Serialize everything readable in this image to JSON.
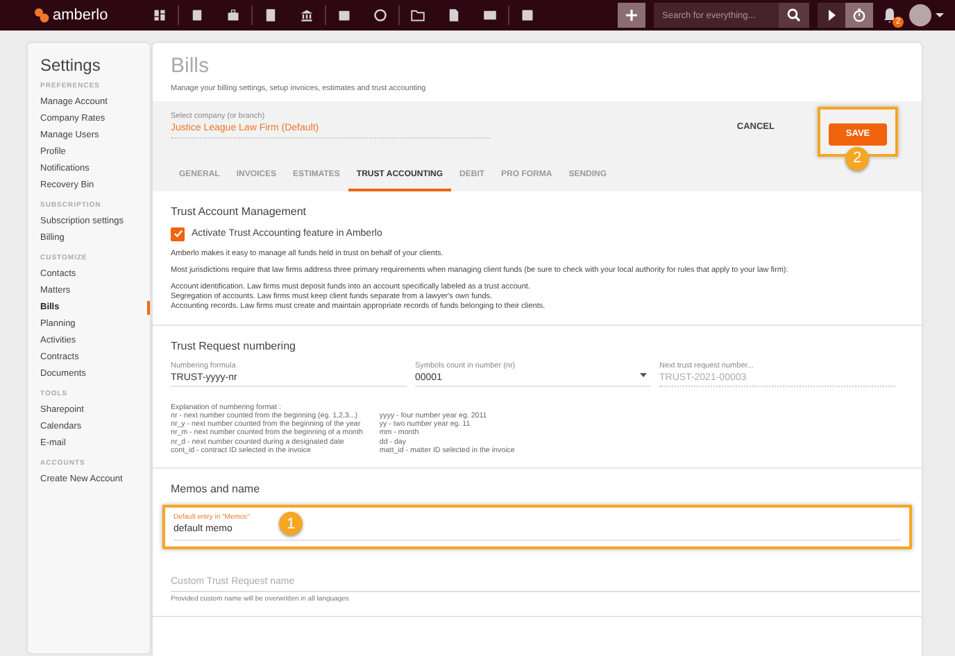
{
  "topbar": {
    "logo": "amberlo",
    "search": {
      "placeholder": "Search for everything..."
    },
    "notification_count": "2"
  },
  "sidebar": {
    "title": "Settings",
    "groups": [
      {
        "heading": "PREFERENCES",
        "items": [
          {
            "label": "Manage Account",
            "selected": false
          },
          {
            "label": "Company Rates",
            "selected": false
          },
          {
            "label": "Manage Users",
            "selected": false
          },
          {
            "label": "Profile",
            "selected": false
          },
          {
            "label": "Notifications",
            "selected": false
          },
          {
            "label": "Recovery Bin",
            "selected": false
          }
        ]
      },
      {
        "heading": "SUBSCRIPTION",
        "items": [
          {
            "label": "Subscription settings",
            "selected": false
          },
          {
            "label": "Billing",
            "selected": false
          }
        ]
      },
      {
        "heading": "CUSTOMIZE",
        "items": [
          {
            "label": "Contacts",
            "selected": false
          },
          {
            "label": "Matters",
            "selected": false
          },
          {
            "label": "Bills",
            "selected": true
          },
          {
            "label": "Planning",
            "selected": false
          },
          {
            "label": "Activities",
            "selected": false
          },
          {
            "label": "Contracts",
            "selected": false
          },
          {
            "label": "Documents",
            "selected": false
          }
        ]
      },
      {
        "heading": "TOOLS",
        "items": [
          {
            "label": "Sharepoint",
            "selected": false
          },
          {
            "label": "Calendars",
            "selected": false
          },
          {
            "label": "E-mail",
            "selected": false
          }
        ]
      },
      {
        "heading": "ACCOUNTS",
        "items": [
          {
            "label": "Create New Account",
            "selected": false
          }
        ]
      }
    ]
  },
  "page": {
    "title": "Bills",
    "subtitle": "Manage your billing settings, setup invoices, estimates and trust accounting",
    "company": {
      "label": "Select company (or branch)",
      "value": "Justice League Law Firm (Default)"
    },
    "cancel": "CANCEL",
    "save": "SAVE",
    "save_annotation": "2",
    "tabs": [
      {
        "label": "GENERAL",
        "selected": false
      },
      {
        "label": "INVOICES",
        "selected": false
      },
      {
        "label": "ESTIMATES",
        "selected": false
      },
      {
        "label": "TRUST ACCOUNTING",
        "selected": true
      },
      {
        "label": "DEBIT",
        "selected": false
      },
      {
        "label": "PRO FORMA",
        "selected": false
      },
      {
        "label": "SENDING",
        "selected": false
      }
    ]
  },
  "trust_account": {
    "title": "Trust Account Management",
    "activate": {
      "label": "Activate Trust Accounting feature in Amberlo",
      "checked": true
    },
    "paragraphs": [
      "Amberlo makes it easy to manage all funds held in trust on behalf of your clients.",
      "Most jurisdictions require that law firms address three primary requirements when managing client funds (be sure to check with your local authority for rules that apply to your law firm):"
    ],
    "requirements": [
      "Account identification. Law firms must deposit funds into an account specifically labeled as a trust account.",
      "Segregation of accounts. Law firms must keep client funds separate from a lawyer's own funds.",
      "Accounting records. Law firms must create and maintain appropriate records of funds belonging to their clients."
    ]
  },
  "numbering": {
    "title": "Trust Request numbering",
    "formula": {
      "label": "Numbering formula",
      "value": "TRUST-yyyy-nr"
    },
    "symbols": {
      "label": "Symbols count in number (nr)",
      "value": "00001"
    },
    "next": {
      "label": "Next trust request number...",
      "value": "TRUST-2021-00003"
    },
    "explanation_title": "Explanation of numbering format :",
    "explanation_left": [
      "nr - next number counted from the beginning (eg. 1,2,3...)",
      "nr_y - next number counted from the beginning of the year",
      "nr_m - next number counted from the beginning of a month",
      "nr_d - next number counted during a designated date",
      "cont_id - contract ID selected in the invoice"
    ],
    "explanation_right": [
      "yyyy - four number year eg. 2011",
      "yy - two number year eg. 11",
      "mm - month",
      "dd - day",
      "matt_id - matter ID selected in the invoice"
    ]
  },
  "memos": {
    "title": "Memos and name",
    "memo": {
      "label": "Default entry in \"Memos\"",
      "value": "default memo"
    },
    "memo_annotation": "1",
    "custom_name": {
      "placeholder": "Custom Trust Request name",
      "hint": "Provided custom name will be overwritten in all languages"
    }
  }
}
